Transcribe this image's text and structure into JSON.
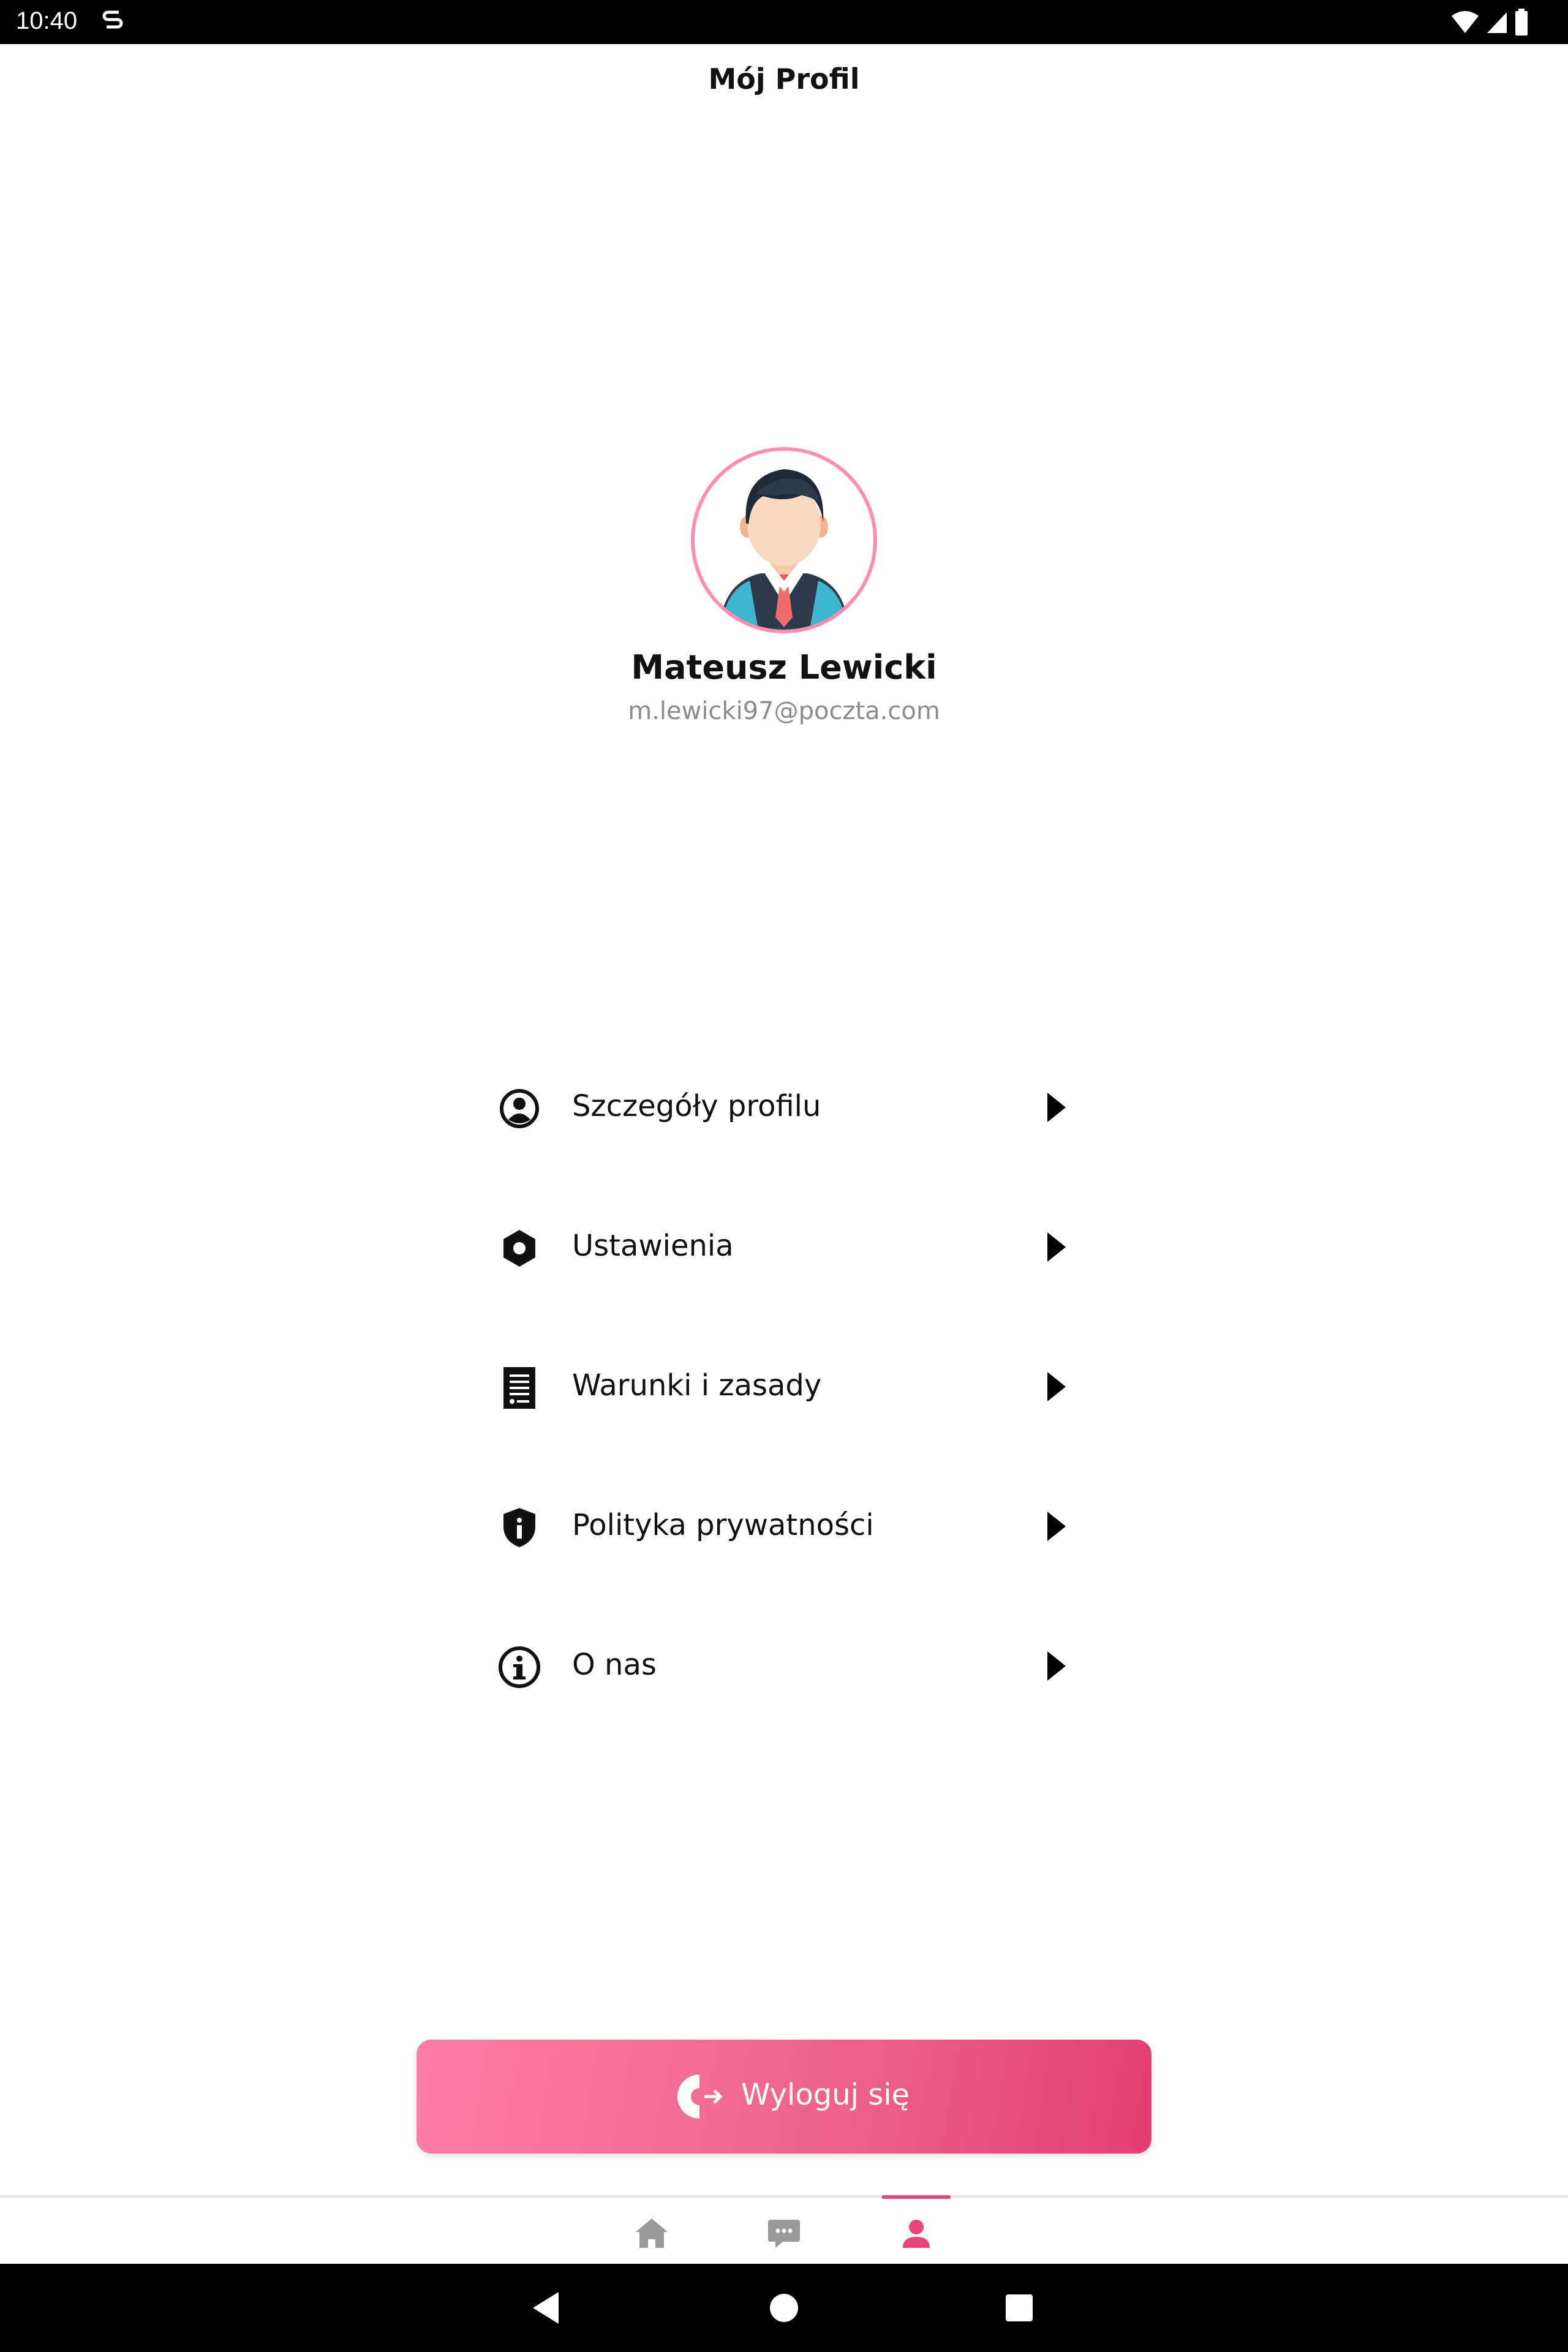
{
  "status_bar": {
    "time": "10:40",
    "icons": [
      "notification-s-icon",
      "wifi-icon",
      "signal-icon",
      "battery-icon"
    ]
  },
  "header": {
    "title": "Mój Profil"
  },
  "profile": {
    "name": "Mateusz Lewicki",
    "email": "m.lewicki97@poczta.com",
    "avatar_icon": "businessman-avatar-icon"
  },
  "menu": {
    "items": [
      {
        "label": "Szczegóły profilu",
        "icon": "account-circle-icon"
      },
      {
        "label": "Ustawienia",
        "icon": "settings-hexagon-icon"
      },
      {
        "label": "Warunki i zasady",
        "icon": "document-icon"
      },
      {
        "label": "Polityka prywatności",
        "icon": "shield-info-icon"
      },
      {
        "label": "O nas",
        "icon": "info-circle-icon"
      }
    ],
    "arrow_icon": "arrow-right-icon"
  },
  "logout": {
    "label": "Wyloguj się",
    "icon": "logout-icon"
  },
  "bottom_nav": {
    "items": [
      {
        "icon": "home-icon",
        "active": false
      },
      {
        "icon": "chat-icon",
        "active": false
      },
      {
        "icon": "profile-icon",
        "active": true
      }
    ]
  },
  "colors": {
    "accent": "#e8457c",
    "button_start": "#fb7ea6",
    "button_end": "#e33e73",
    "nav_inactive": "#9a9a9a",
    "email_gray": "#8b8b8b"
  },
  "system_nav": [
    "back-icon",
    "home-circle-icon",
    "recents-icon"
  ]
}
